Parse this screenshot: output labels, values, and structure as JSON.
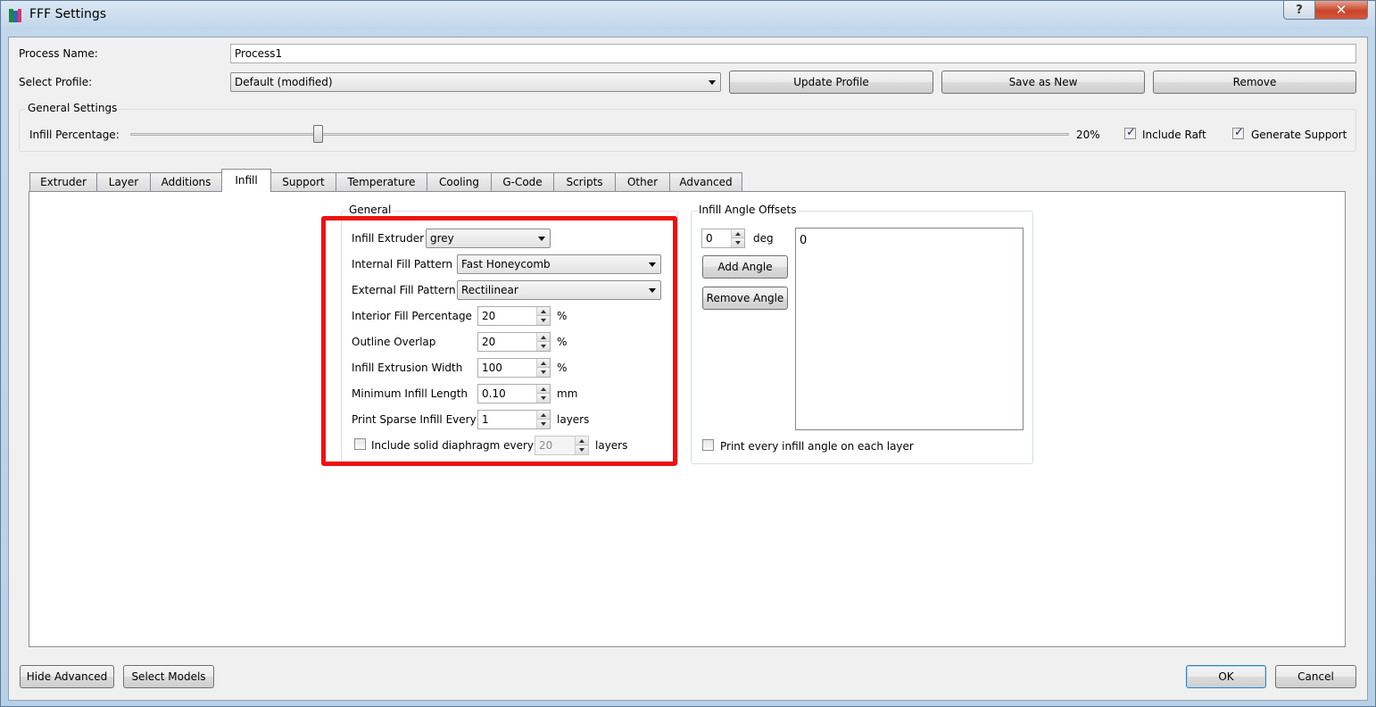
{
  "window": {
    "title": "FFF Settings",
    "help_glyph": "?",
    "close_glyph": "✕"
  },
  "process": {
    "name_label": "Process Name:",
    "name_value": "Process1",
    "profile_label": "Select Profile:",
    "profile_value": "Default (modified)",
    "update_profile": "Update Profile",
    "save_as_new": "Save as New",
    "remove": "Remove"
  },
  "general_settings": {
    "title": "General Settings",
    "infill_label": "Infill Percentage:",
    "infill_value": "20%",
    "infill_fraction": 0.2,
    "include_raft_label": "Include Raft",
    "include_raft_checked": true,
    "generate_support_label": "Generate Support",
    "generate_support_checked": true
  },
  "tabs": [
    {
      "label": "Extruder"
    },
    {
      "label": "Layer"
    },
    {
      "label": "Additions"
    },
    {
      "label": "Infill"
    },
    {
      "label": "Support"
    },
    {
      "label": "Temperature"
    },
    {
      "label": "Cooling"
    },
    {
      "label": "G-Code"
    },
    {
      "label": "Scripts"
    },
    {
      "label": "Other"
    },
    {
      "label": "Advanced"
    }
  ],
  "active_tab": "Infill",
  "infill_general": {
    "title": "General",
    "extruder_label": "Infill Extruder",
    "extruder_value": "grey",
    "internal_pattern_label": "Internal Fill Pattern",
    "internal_pattern_value": "Fast Honeycomb",
    "external_pattern_label": "External Fill Pattern",
    "external_pattern_value": "Rectilinear",
    "rows": [
      {
        "label": "Interior Fill Percentage",
        "value": "20",
        "unit": "%"
      },
      {
        "label": "Outline Overlap",
        "value": "20",
        "unit": "%"
      },
      {
        "label": "Infill Extrusion Width",
        "value": "100",
        "unit": "%"
      },
      {
        "label": "Minimum Infill Length",
        "value": "0.10",
        "unit": "mm"
      },
      {
        "label": "Print Sparse Infill Every",
        "value": "1",
        "unit": "layers"
      }
    ],
    "diaphragm_label": "Include solid diaphragm every",
    "diaphragm_checked": false,
    "diaphragm_value": "20",
    "diaphragm_unit": "layers"
  },
  "angle_offsets": {
    "title": "Infill Angle Offsets",
    "angle_value": "0",
    "angle_unit": "deg",
    "add_angle": "Add Angle",
    "remove_angle": "Remove Angle",
    "list_items": [
      "0"
    ],
    "print_every_label": "Print every infill angle on each layer",
    "print_every_checked": false
  },
  "footer": {
    "hide_advanced": "Hide Advanced",
    "select_models": "Select Models",
    "ok": "OK",
    "cancel": "Cancel"
  },
  "colors": {
    "highlight": "#ee1111",
    "checkmark": "#1b2d6b"
  }
}
